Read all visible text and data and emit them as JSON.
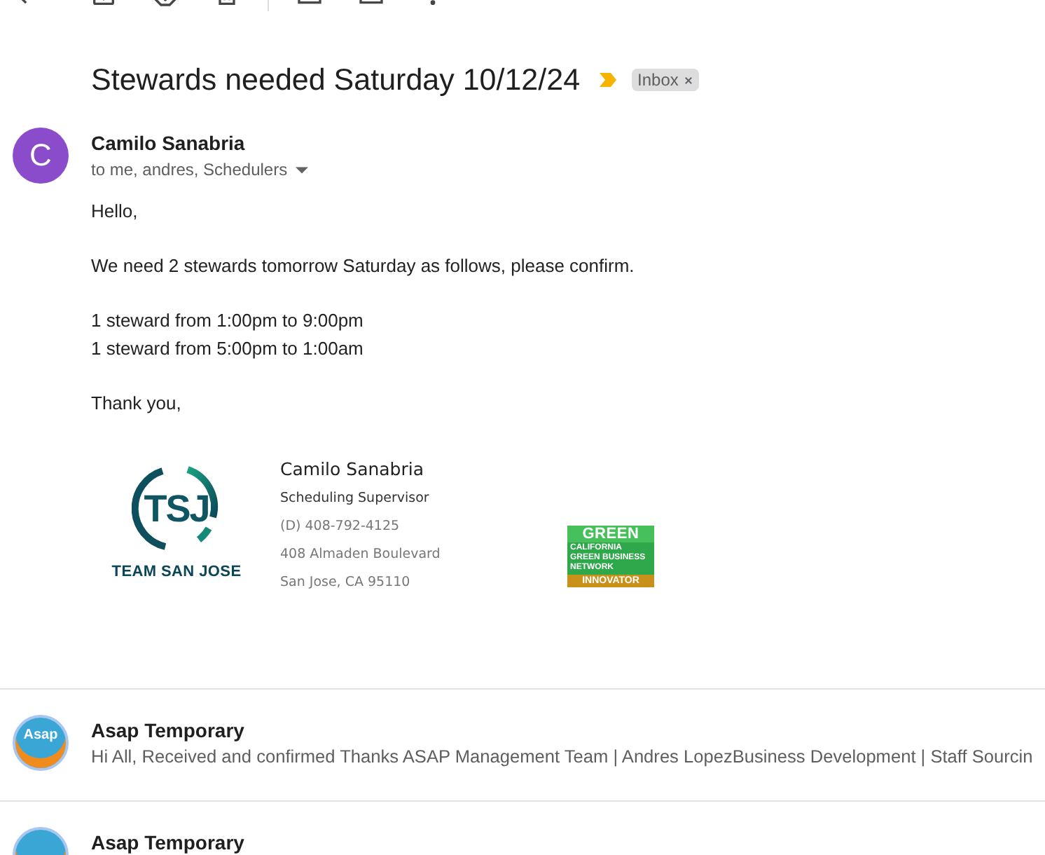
{
  "subject": "Stewards needed Saturday 10/12/24",
  "important": true,
  "labels": [
    {
      "label": "Inbox"
    }
  ],
  "message": {
    "sender": {
      "name": "Camilo Sanabria",
      "initial": "C"
    },
    "recipients": "to me, andres, Schedulers",
    "paragraphs": [
      [
        "Hello,"
      ],
      [
        "We need 2 stewards tomorrow Saturday as follows, please confirm."
      ],
      [
        "1 steward from 1:00pm to 9:00pm",
        "1 steward from 5:00pm to 1:00am"
      ],
      [
        "Thank you,"
      ]
    ],
    "signature": {
      "logo": {
        "monogram": "TSJ",
        "wordmark": "TEAM SAN JOSE"
      },
      "lines": [
        {
          "kind": "name",
          "text": "Camilo Sanabria"
        },
        {
          "kind": "title",
          "text": "Scheduling Supervisor"
        },
        {
          "kind": "detail",
          "text": "(D) 408-792-4125"
        },
        {
          "kind": "detail",
          "text": "408 Almaden Boulevard"
        },
        {
          "kind": "detail",
          "text": "San Jose, CA 95110"
        }
      ],
      "badge": {
        "title": "GREEN",
        "subtitle": "CALIFORNIA GREEN BUSINESS NETWORK",
        "ribbon": "INNOVATOR"
      }
    }
  },
  "thread": [
    {
      "sender": "Asap Temporary",
      "logo_text": "Asap",
      "snippet": "Hi All, Received and confirmed Thanks ASAP Management Team | Andres LopezBusiness Development | Staff Sourcin"
    },
    {
      "sender": "Asap Temporary"
    }
  ]
}
